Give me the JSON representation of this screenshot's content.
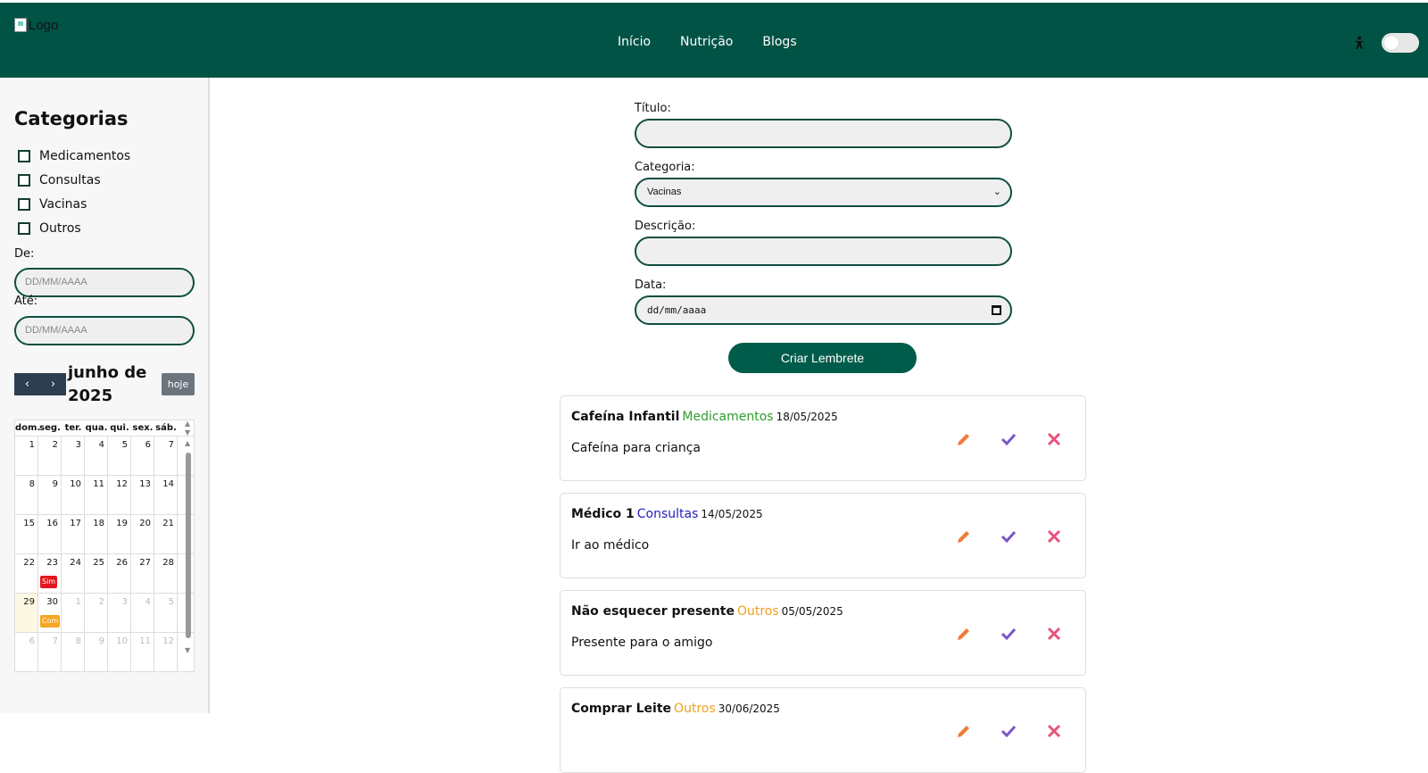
{
  "header": {
    "logo_alt": "Logo",
    "nav": [
      "Início",
      "Nutrição",
      "Blogs"
    ]
  },
  "sidebar": {
    "title": "Categorias",
    "categories": [
      "Medicamentos",
      "Consultas",
      "Vacinas",
      "Outros"
    ],
    "from_label": "De:",
    "from_placeholder": "DD/MM/AAAA",
    "to_label": "Até:",
    "to_placeholder": "DD/MM/AAAA"
  },
  "calendar": {
    "title": "junho de 2025",
    "prev": "‹",
    "next": "›",
    "today_btn": "hoje",
    "weekdays": [
      "dom.",
      "seg.",
      "ter.",
      "qua.",
      "qui.",
      "sex.",
      "sáb."
    ],
    "weeks": [
      [
        "1",
        "2",
        "3",
        "4",
        "5",
        "6",
        "7"
      ],
      [
        "8",
        "9",
        "10",
        "11",
        "12",
        "13",
        "14"
      ],
      [
        "15",
        "16",
        "17",
        "18",
        "19",
        "20",
        "21"
      ],
      [
        "22",
        "23",
        "24",
        "25",
        "26",
        "27",
        "28"
      ],
      [
        "29",
        "30",
        "1",
        "2",
        "3",
        "4",
        "5"
      ],
      [
        "6",
        "7",
        "8",
        "9",
        "10",
        "11",
        "12"
      ]
    ],
    "events": [
      {
        "week": 3,
        "day": 1,
        "label": "Sim",
        "color": "#e3161d"
      },
      {
        "week": 4,
        "day": 1,
        "label": "Com",
        "color": "#f5a623"
      }
    ]
  },
  "form": {
    "titulo_label": "Título:",
    "titulo_value": "",
    "categoria_label": "Categoria:",
    "categoria_value": "Vacinas",
    "descricao_label": "Descrição:",
    "descricao_value": "",
    "data_label": "Data:",
    "data_placeholder": "dd/mm/aaaa",
    "submit": "Criar Lembrete"
  },
  "reminders": [
    {
      "title": "Cafeína Infantil",
      "category": "Medicamentos",
      "cat_color": "#2e9e2e",
      "date": "18/05/2025",
      "desc": "Cafeína para criança"
    },
    {
      "title": "Médico 1",
      "category": "Consultas",
      "cat_color": "#2222bb",
      "date": "14/05/2025",
      "desc": "Ir ao médico"
    },
    {
      "title": "Não esquecer presente",
      "category": "Outros",
      "cat_color": "#f0a020",
      "date": "05/05/2025",
      "desc": "Presente para o amigo"
    },
    {
      "title": "Comprar Leite",
      "category": "Outros",
      "cat_color": "#f0a020",
      "date": "30/06/2025",
      "desc": ""
    }
  ],
  "colors": {
    "brand": "#005345",
    "edit": "#f07c3a",
    "check": "#7a55c8",
    "delete": "#e8537a"
  }
}
